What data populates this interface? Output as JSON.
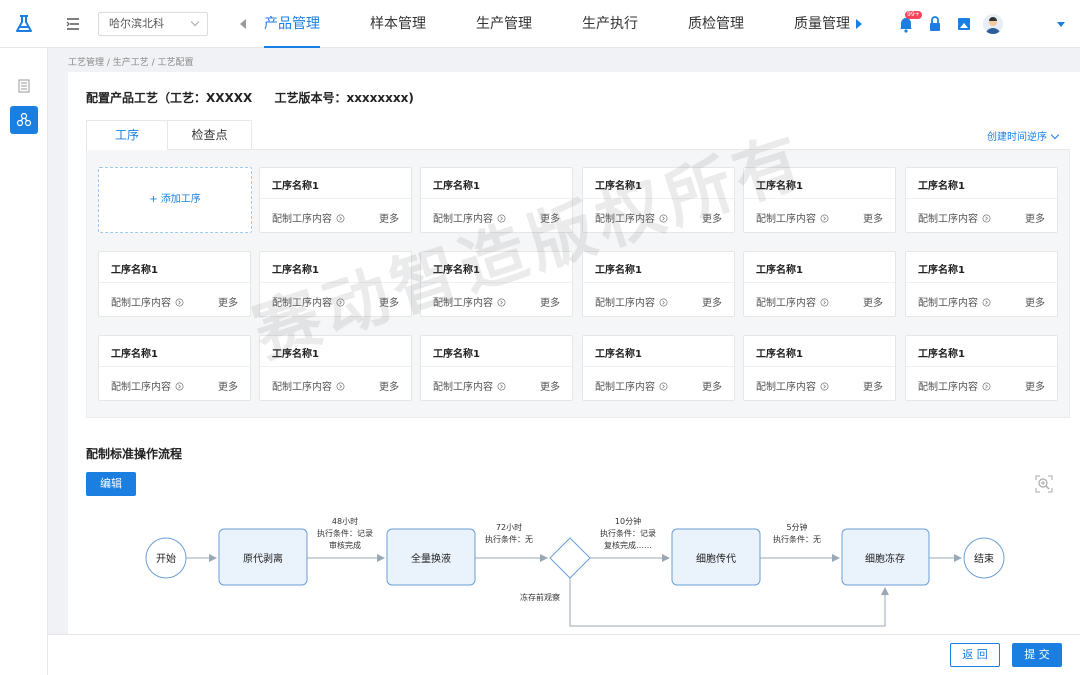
{
  "header": {
    "factory": "哈尔滨北科",
    "nav": [
      "产品管理",
      "样本管理",
      "生产管理",
      "生产执行",
      "质检管理",
      "质量管理"
    ],
    "active_nav": 0,
    "notification_badge": "99+"
  },
  "breadcrumb": "工艺管理 / 生产工艺 / 工艺配置",
  "title": {
    "process": "配置产品工艺（工艺：XXXXX",
    "version": "工艺版本号：xxxxxxxx)"
  },
  "tabs": [
    "工序",
    "检查点"
  ],
  "sort_label": "创建时间逆序",
  "add_step_label": "+ 添加工序",
  "step_cards": [
    {
      "name": "工序名称1",
      "desc": "配制工序内容",
      "more": "更多"
    },
    {
      "name": "工序名称1",
      "desc": "配制工序内容",
      "more": "更多"
    },
    {
      "name": "工序名称1",
      "desc": "配制工序内容",
      "more": "更多"
    },
    {
      "name": "工序名称1",
      "desc": "配制工序内容",
      "more": "更多"
    },
    {
      "name": "工序名称1",
      "desc": "配制工序内容",
      "more": "更多"
    },
    {
      "name": "工序名称1",
      "desc": "配制工序内容",
      "more": "更多"
    },
    {
      "name": "工序名称1",
      "desc": "配制工序内容",
      "more": "更多"
    },
    {
      "name": "工序名称1",
      "desc": "配制工序内容",
      "more": "更多"
    },
    {
      "name": "工序名称1",
      "desc": "配制工序内容",
      "more": "更多"
    },
    {
      "name": "工序名称1",
      "desc": "配制工序内容",
      "more": "更多"
    },
    {
      "name": "工序名称1",
      "desc": "配制工序内容",
      "more": "更多"
    },
    {
      "name": "工序名称1",
      "desc": "配制工序内容",
      "more": "更多"
    },
    {
      "name": "工序名称1",
      "desc": "配制工序内容",
      "more": "更多"
    },
    {
      "name": "工序名称1",
      "desc": "配制工序内容",
      "more": "更多"
    },
    {
      "name": "工序名称1",
      "desc": "配制工序内容",
      "more": "更多"
    },
    {
      "name": "工序名称1",
      "desc": "配制工序内容",
      "more": "更多"
    },
    {
      "name": "工序名称1",
      "desc": "配制工序内容",
      "more": "更多"
    }
  ],
  "sop": {
    "title": "配制标准操作流程",
    "edit_label": "编辑",
    "nodes": {
      "start": "开始",
      "step1": "原代剥离",
      "step2": "全量换液",
      "step3": "细胞传代",
      "step4": "细胞冻存",
      "end": "结束"
    },
    "edge1": [
      "48小时",
      "执行条件：记录",
      "审核完成"
    ],
    "edge2": [
      "72小时",
      "执行条件：无"
    ],
    "edge3": [
      "10分钟",
      "执行条件：记录",
      "复核完成……"
    ],
    "edge4": [
      "5分钟",
      "执行条件：无"
    ],
    "branch_label": "冻存前观察"
  },
  "footer": {
    "back_label": "返 回",
    "submit_label": "提 交"
  },
  "watermark": "赛动智造版权所有",
  "colors": {
    "primary": "#1a7fe0",
    "node_fill": "#eaf2fc",
    "node_stroke": "#6b9fd6"
  }
}
